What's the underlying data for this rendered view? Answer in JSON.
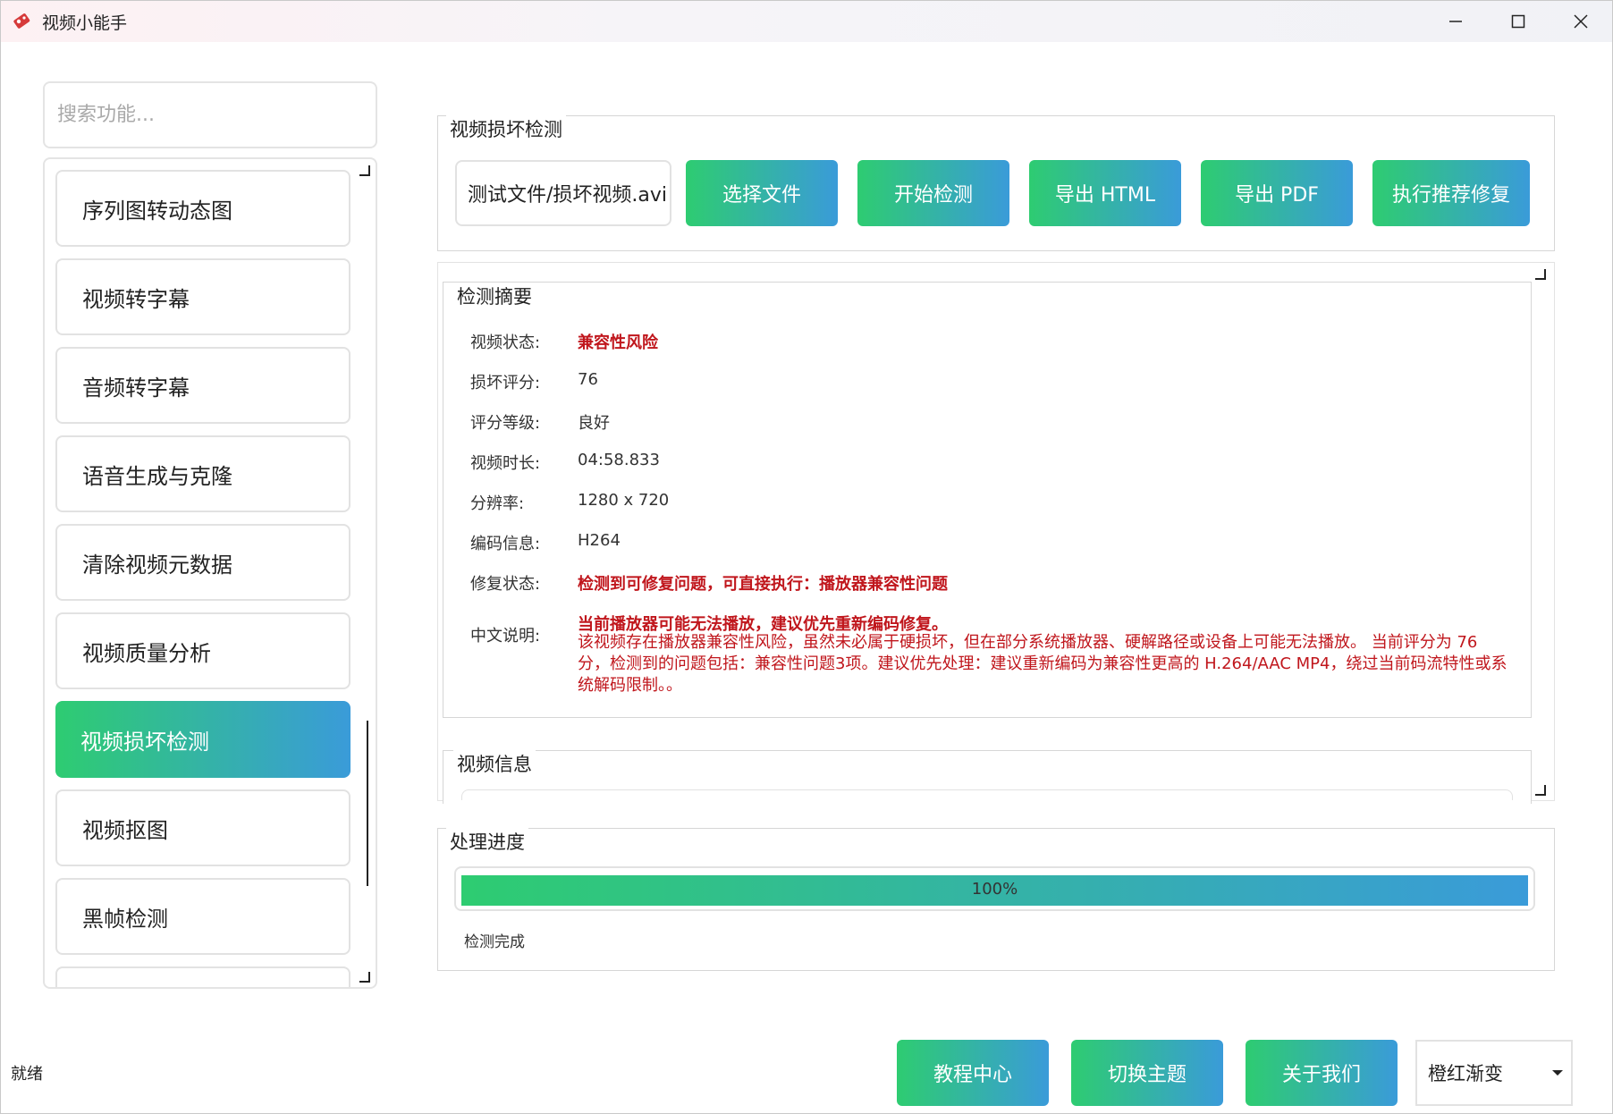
{
  "window": {
    "title": "视频小能手",
    "icon": "app-icon"
  },
  "sidebar": {
    "search_placeholder": "搜索功能...",
    "items": [
      {
        "label": "序列图转动态图"
      },
      {
        "label": "视频转字幕"
      },
      {
        "label": "音频转字幕"
      },
      {
        "label": "语音生成与克隆"
      },
      {
        "label": "清除视频元数据"
      },
      {
        "label": "视频质量分析"
      },
      {
        "label": "视频损坏检测",
        "active": true
      },
      {
        "label": "视频抠图"
      },
      {
        "label": "黑帧检测"
      }
    ]
  },
  "detect_group": {
    "title": "视频损坏检测",
    "file_name": "测试文件/损坏视频.avi",
    "buttons": {
      "select_file": "选择文件",
      "start_detect": "开始检测",
      "export_html": "导出 HTML",
      "export_pdf": "导出 PDF",
      "run_repair": "执行推荐修复"
    }
  },
  "summary": {
    "title": "检测摘要",
    "rows": [
      {
        "label": "视频状态:",
        "value": "兼容性风险"
      },
      {
        "label": "损坏评分:",
        "value": "76"
      },
      {
        "label": "评分等级:",
        "value": "良好"
      },
      {
        "label": "视频时长:",
        "value": "04:58.833"
      },
      {
        "label": "分辨率:",
        "value": "1280 x 720"
      },
      {
        "label": "编码信息:",
        "value": "H264"
      },
      {
        "label": "修复状态:",
        "value": "检测到可修复问题，可直接执行：播放器兼容性问题"
      }
    ],
    "desc_label": "中文说明:",
    "desc_headline": "当前播放器可能无法播放，建议优先重新编码修复。",
    "desc_body": "该视频存在播放器兼容性风险，虽然未必属于硬损坏，但在部分系统播放器、硬解路径或设备上可能无法播放。 当前评分为 76 分，检测到的问题包括：兼容性问题3项。建议优先处理：建议重新编码为兼容性更高的 H.264/AAC MP4，绕过当前码流特性或系统解码限制。。"
  },
  "video_info": {
    "title": "视频信息"
  },
  "progress": {
    "title": "处理进度",
    "value": 1.0,
    "text": "100%",
    "status": "检测完成"
  },
  "footer": {
    "status": "就绪",
    "tutorial": "教程中心",
    "switch_theme": "切换主题",
    "about": "关于我们",
    "theme_value": "橙红渐变"
  },
  "colors": {
    "accent_start": "#2ecc71",
    "accent_end": "#3a9bd9",
    "warning_red": "#c0161c"
  }
}
